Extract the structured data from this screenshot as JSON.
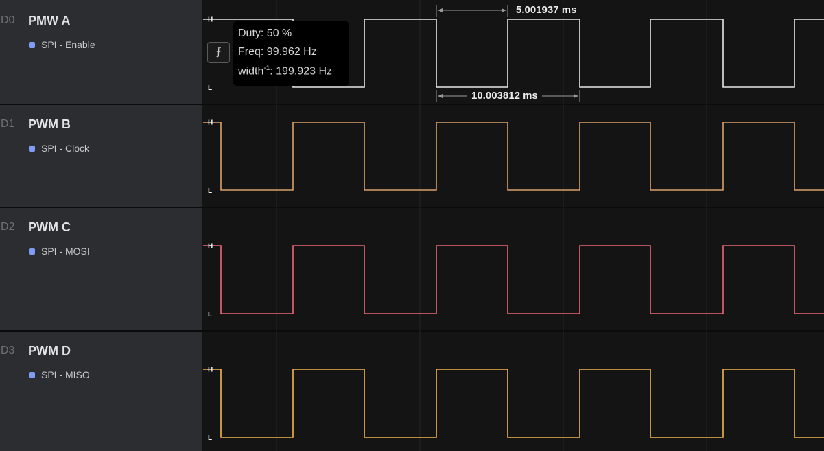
{
  "channels": [
    {
      "id": "D0",
      "name": "PMW A",
      "analyzer": "SPI - Enable",
      "color": "#e6e6e6"
    },
    {
      "id": "D1",
      "name": "PWM B",
      "analyzer": "SPI - Clock",
      "color": "#d9a06b"
    },
    {
      "id": "D2",
      "name": "PWM C",
      "analyzer": "SPI - MOSI",
      "color": "#ee6677"
    },
    {
      "id": "D3",
      "name": "PWM D",
      "analyzer": "SPI - MISO",
      "color": "#f2b44f"
    }
  ],
  "analyzer_color": "#7f9cf5",
  "level_labels": {
    "high": "H",
    "low": "L"
  },
  "tooltip": {
    "duty": "Duty: 50 %",
    "freq": "Freq: 99.962 Hz",
    "width_prefix": "width",
    "width_exp": "-1",
    "width_suffix": ": 199.923 Hz"
  },
  "edge_button_icon": "edge-nav-icon",
  "measurements": {
    "pulse_width": "5.001937 ms",
    "period": "10.003812 ms"
  }
}
